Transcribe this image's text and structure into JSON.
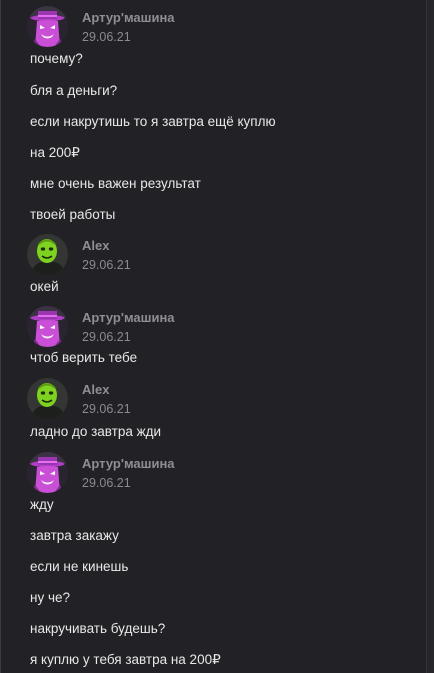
{
  "chat": {
    "groups": [
      {
        "author": "Артур'машина",
        "time": "29.06.21",
        "avatar_icon": "purple-hat-character-avatar",
        "messages": [
          "почему?",
          "бля а деньги?",
          "если накрутишь то я завтра ещё куплю",
          "на 200₽",
          "мне очень важен результат",
          "твоей работы"
        ]
      },
      {
        "author": "Alex",
        "time": "29.06.21",
        "avatar_icon": "green-mask-avatar",
        "messages": [
          "окей"
        ]
      },
      {
        "author": "Артур'машина",
        "time": "29.06.21",
        "avatar_icon": "purple-hat-character-avatar",
        "messages": [
          "чтоб верить тебе"
        ]
      },
      {
        "author": "Alex",
        "time": "29.06.21",
        "avatar_icon": "green-mask-avatar",
        "messages": [
          "ладно до завтра жди"
        ]
      },
      {
        "author": "Артур'машина",
        "time": "29.06.21",
        "avatar_icon": "purple-hat-character-avatar",
        "messages": [
          "жду",
          "завтра закажу",
          "если не кинешь",
          "ну че?",
          "накручивать будешь?",
          "я куплю у тебя завтра на 200₽"
        ]
      }
    ]
  },
  "colors": {
    "background": "#222226",
    "author": "#8e8e93",
    "message": "#e8e8e8",
    "avatar_arthur": "#c84fd6",
    "avatar_alex": "#7ed321"
  }
}
